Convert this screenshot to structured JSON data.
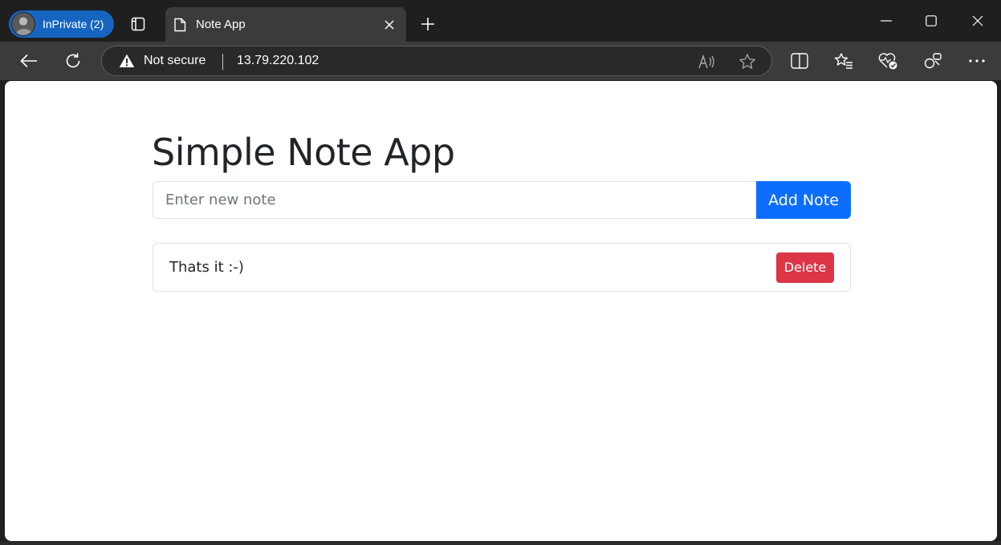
{
  "browser": {
    "profile_label": "InPrivate (2)",
    "tab": {
      "title": "Note App"
    },
    "address": {
      "security_label": "Not secure",
      "url": "13.79.220.102"
    }
  },
  "icons": {
    "tab_actions": "tab-actions-icon",
    "favicon": "page-icon",
    "tab_close": "close-icon",
    "new_tab": "plus-icon",
    "minimize": "minimize-icon",
    "maximize": "maximize-icon",
    "window_close": "close-icon",
    "back": "back-arrow-icon",
    "refresh": "refresh-icon",
    "warning": "warning-icon",
    "read_aloud": "read-aloud-icon",
    "favorite": "star-icon",
    "split_screen": "split-screen-icon",
    "favorites": "favorites-icon",
    "browser_essentials": "heart-pulse-icon",
    "extensions": "extensions-icon",
    "more": "more-icon"
  },
  "page": {
    "title": "Simple Note App",
    "input": {
      "placeholder": "Enter new note",
      "value": ""
    },
    "add_button_label": "Add Note",
    "notes": [
      {
        "text": "Thats it :-)",
        "delete_label": "Delete"
      }
    ]
  },
  "colors": {
    "primary": "#0d6efd",
    "danger": "#dc3545",
    "inprivate": "#1565c0",
    "chrome_dark": "#1f1f1f",
    "chrome_toolbar": "#3b3b3b"
  }
}
